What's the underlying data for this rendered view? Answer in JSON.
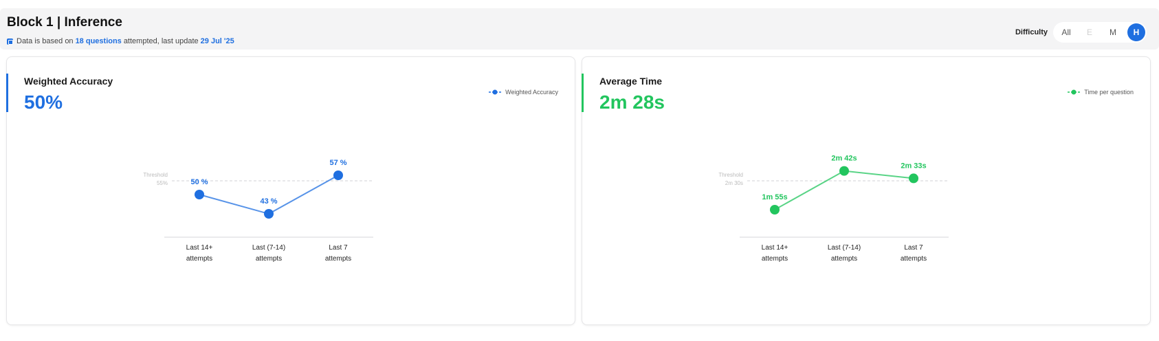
{
  "header": {
    "title": "Block 1 | Inference",
    "sub_prefix": "Data is based on",
    "questions": "18 questions",
    "sub_mid": "attempted, last update",
    "date": "29 Jul '25"
  },
  "difficulty": {
    "label": "Difficulty",
    "options": [
      "All",
      "E",
      "M",
      "H"
    ],
    "selected": "H"
  },
  "colors": {
    "accuracy": "#1f6fe0",
    "time": "#22c55e",
    "threshold": "#c8c8c8"
  },
  "cards": {
    "accuracy": {
      "title": "Weighted Accuracy",
      "value": "50%",
      "legend": "Weighted Accuracy",
      "threshold_label": [
        "Threshold",
        "55%"
      ]
    },
    "time": {
      "title": "Average Time",
      "value": "2m 28s",
      "legend": "Time per question",
      "threshold_label": [
        "Threshold",
        "2m 30s"
      ]
    }
  },
  "chart_data": [
    {
      "type": "line",
      "categories": [
        [
          "Last 14+",
          "attempts"
        ],
        [
          "Last (7-14)",
          "attempts"
        ],
        [
          "Last 7",
          "attempts"
        ]
      ],
      "series": [
        {
          "name": "Weighted Accuracy",
          "values": [
            50,
            43,
            57
          ]
        }
      ],
      "data_labels": [
        "50 %",
        "43 %",
        "57 %"
      ],
      "threshold": 55,
      "ylim": [
        25,
        70
      ]
    },
    {
      "type": "line",
      "categories": [
        [
          "Last 14+",
          "attempts"
        ],
        [
          "Last (7-14)",
          "attempts"
        ],
        [
          "Last 7",
          "attempts"
        ]
      ],
      "series": [
        {
          "name": "Time per question",
          "values": [
            115,
            162,
            153
          ]
        }
      ],
      "data_labels": [
        "1m 55s",
        "2m 42s",
        "2m 33s"
      ],
      "threshold": 150,
      "ylim": [
        50,
        200
      ]
    }
  ]
}
